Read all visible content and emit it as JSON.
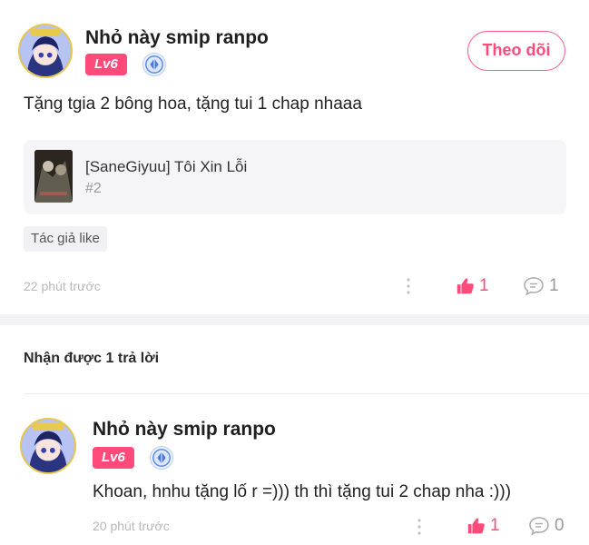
{
  "post": {
    "username": "Nhỏ này smip ranpo",
    "level": "Lv6",
    "follow_label": "Theo dõi",
    "content": "Tặng tgia 2 bông hoa, tặng tui 1 chap nhaaa",
    "story": {
      "title": "[SaneGiyuu] Tôi Xin Lỗi",
      "chapter": "#2"
    },
    "tag": "Tác giả like",
    "time": "22 phút trước",
    "likes": "1",
    "comments": "1"
  },
  "replies_section": {
    "title": "Nhận được 1 trả lời"
  },
  "reply": {
    "username": "Nhỏ này smip ranpo",
    "level": "Lv6",
    "content": "Khoan, hnhu tặng lố r =))) th thì tặng tui 2 chap nha :)))",
    "time": "20 phút trước",
    "likes": "1",
    "comments": "0"
  },
  "icons": {
    "like": "thumbs-up-icon",
    "comment": "comment-bubble-icon",
    "more": "more-vertical-icon",
    "badge": "blue-crystal-badge-icon"
  },
  "colors": {
    "accent": "#ff4a7a",
    "muted": "#b8b8b8",
    "card_bg": "#f5f5f7"
  }
}
